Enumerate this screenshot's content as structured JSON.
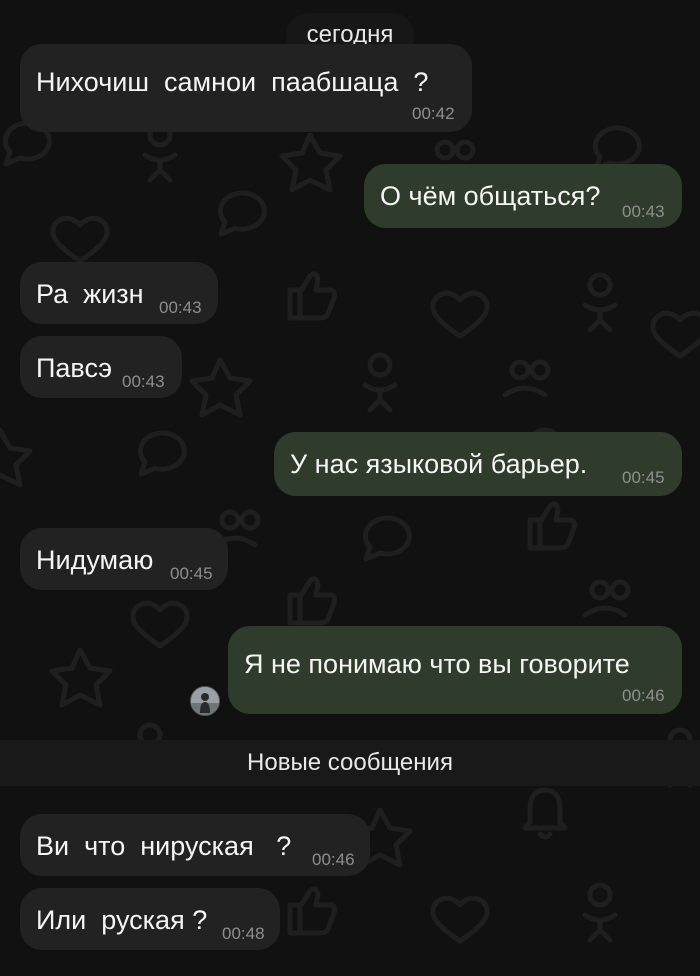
{
  "date_separator": "сегодня",
  "new_messages_divider": "Новые сообщения",
  "messages": [
    {
      "direction": "in",
      "text": "Нихочиш  самнои  паабшаца  ?",
      "time": "00:42"
    },
    {
      "direction": "out",
      "text": "О чём общаться?",
      "time": "00:43"
    },
    {
      "direction": "in",
      "text": "Ра  жизн",
      "time": "00:43"
    },
    {
      "direction": "in",
      "text": "Павсэ",
      "time": "00:43"
    },
    {
      "direction": "out",
      "text": "У нас языковой барьер.",
      "time": "00:45"
    },
    {
      "direction": "in",
      "text": "Нидумаю",
      "time": "00:45"
    },
    {
      "direction": "out",
      "text": "Я не понимаю что вы говорите",
      "time": "00:46"
    },
    {
      "direction": "in",
      "text": "Ви  что  нируская   ?",
      "time": "00:46"
    },
    {
      "direction": "in",
      "text": "Или  руская ?",
      "time": "00:48"
    }
  ],
  "colors": {
    "background": "#111111",
    "incoming_bubble": "#222222",
    "outgoing_bubble": "#303c2b",
    "timestamp": "#8e8e8e"
  },
  "icons": [
    "wallpaper-pattern-icon",
    "user-avatar"
  ]
}
